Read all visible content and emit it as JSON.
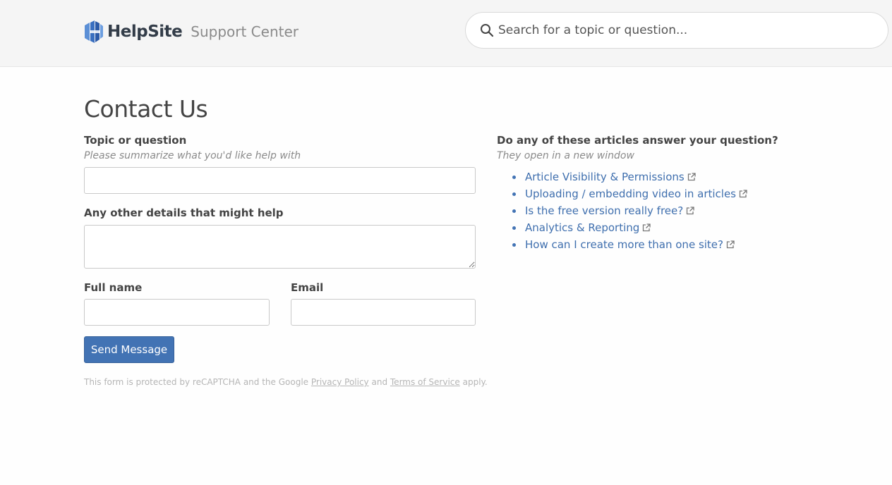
{
  "header": {
    "logo_text": "HelpSite",
    "site_subtitle": "Support Center",
    "search_placeholder": "Search for a topic or question..."
  },
  "page": {
    "title": "Contact Us"
  },
  "form": {
    "topic_label": "Topic or question",
    "topic_hint": "Please summarize what you'd like help with",
    "topic_value": "",
    "details_label": "Any other details that might help",
    "details_value": "",
    "name_label": "Full name",
    "name_value": "",
    "email_label": "Email",
    "email_value": "",
    "submit_label": "Send Message",
    "recaptcha": {
      "prefix": "This form is protected by reCAPTCHA and the Google",
      "privacy_link": "Privacy Policy",
      "and": "and",
      "terms_link": "Terms of Service",
      "suffix": "apply."
    }
  },
  "suggestions": {
    "heading": "Do any of these articles answer your question?",
    "subheading": "They open in a new window",
    "items": [
      {
        "label": "Article Visibility & Permissions",
        "icon": "external-link-icon"
      },
      {
        "label": "Uploading / embedding video in articles",
        "icon": "external-link-icon"
      },
      {
        "label": "Is the free version really free?",
        "icon": "external-link-icon"
      },
      {
        "label": "Analytics & Reporting",
        "icon": "external-link-icon"
      },
      {
        "label": "How can I create more than one site?",
        "icon": "external-link-icon"
      }
    ]
  },
  "colors": {
    "header_bg": "#f5f5f5",
    "accent": "#4273b4",
    "link": "#3f6fae",
    "logo_navy": "#333d49"
  },
  "icons": {
    "logo": "helpsite-logo-icon",
    "search": "search-icon"
  }
}
